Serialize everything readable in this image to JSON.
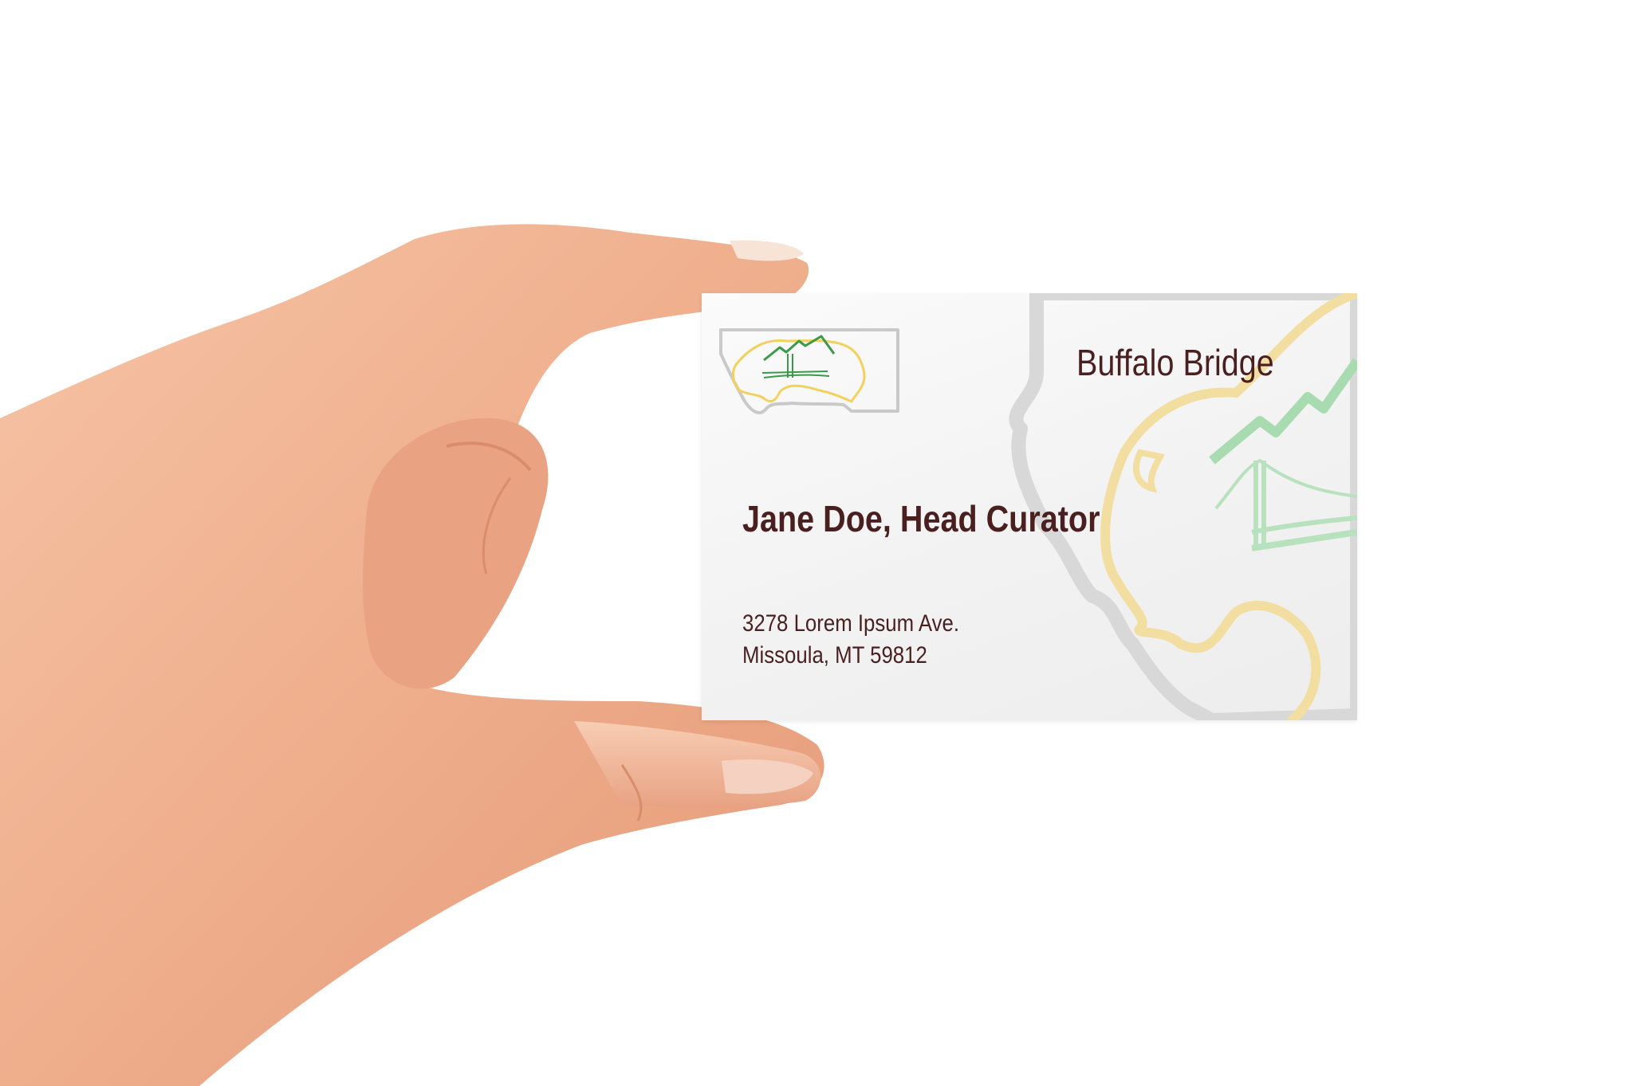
{
  "card": {
    "brand_name": "Buffalo Bridge",
    "person_line": "Jane Doe, Head Curator",
    "address_line_1": "3278 Lorem Ipsum Ave.",
    "address_line_2": "Missoula, MT 59812"
  },
  "colors": {
    "text": "#4a1f1f",
    "buffalo_outline": "#f2d15c",
    "mountain_green": "#3a9a48",
    "state_outline": "#c9c9c9",
    "skin": "#f2b08e"
  },
  "icons": [
    "hand",
    "buffalo-bridge-logo-icon",
    "montana-outline-icon"
  ]
}
